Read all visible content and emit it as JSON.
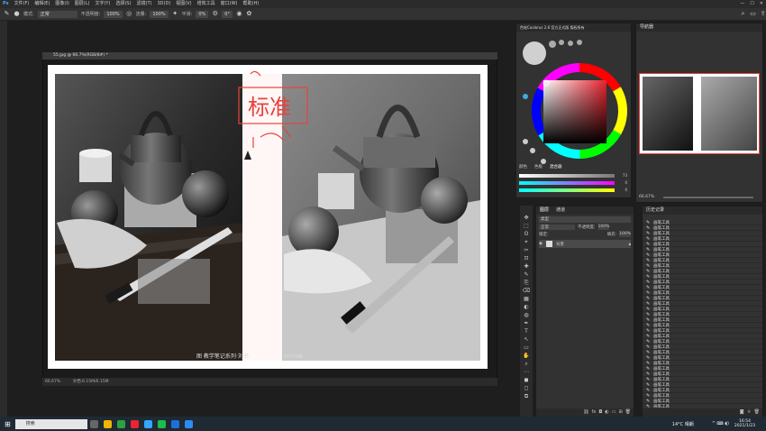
{
  "menubar": {
    "items": [
      "文件(F)",
      "编辑(E)",
      "图像(I)",
      "图层(L)",
      "文字(Y)",
      "选择(S)",
      "滤镜(T)",
      "3D(D)",
      "视图(V)",
      "增效工具",
      "窗口(W)",
      "帮助(H)"
    ]
  },
  "options": {
    "mode_label": "模式:",
    "mode_value": "正常",
    "opacity_label": "不透明度:",
    "opacity_value": "100%",
    "flow_label": "流量:",
    "flow_value": "100%",
    "smooth_label": "平滑:",
    "smooth_value": "0%",
    "angle_value": "0°"
  },
  "document": {
    "tab_title": "55.jpg @ 66.7%(RGB/8#) *",
    "zoom": "66.67%",
    "doc_size": "文档:6.15M/6.15M",
    "annotation": "标准",
    "watermark_left": "图 教学笔记系列·刘书",
    "watermark_right": "50770库"
  },
  "color_panel": {
    "title": "色轮Coolorus 2.6 官方正式版 版权所有",
    "tabs": [
      "颜色",
      "色板",
      "混合器"
    ],
    "slider_values": [
      "73",
      "0",
      "0"
    ]
  },
  "navigator": {
    "title": "导航器",
    "zoom": "66.67%"
  },
  "layers": {
    "tabs": [
      "图层",
      "通道"
    ],
    "kind_label": "类型",
    "blend_label": "正常",
    "opacity_label": "不透明度:",
    "opacity_value": "100%",
    "lock_label": "锁定:",
    "fill_label": "填充:",
    "fill_value": "100%",
    "layer_name": "背景"
  },
  "history": {
    "title": "历史记录",
    "item_label": "画笔工具",
    "count": 36
  },
  "taskbar": {
    "search": "搜索",
    "weather": "14°C 晴朗",
    "time": "16:54",
    "date": "2021/1/23"
  },
  "colors": {
    "accent_red": "#e8423c",
    "panel": "#323232"
  }
}
